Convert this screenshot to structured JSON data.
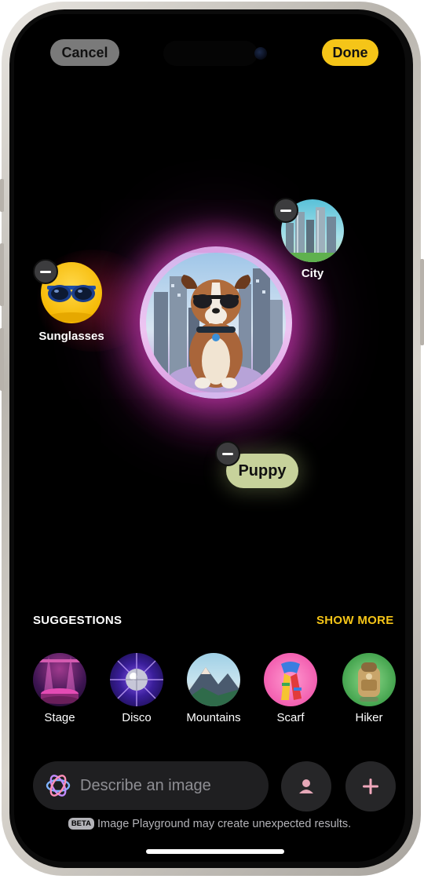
{
  "toolbar": {
    "cancel_label": "Cancel",
    "done_label": "Done"
  },
  "concepts": {
    "sunglasses_label": "Sunglasses",
    "city_label": "City",
    "puppy_label": "Puppy"
  },
  "suggestions": {
    "title": "SUGGESTIONS",
    "show_more_label": "SHOW MORE",
    "items": [
      {
        "label": "Stage"
      },
      {
        "label": "Disco"
      },
      {
        "label": "Mountains"
      },
      {
        "label": "Scarf"
      },
      {
        "label": "Hiker"
      }
    ]
  },
  "prompt": {
    "placeholder": "Describe an image"
  },
  "footer": {
    "beta_badge": "BETA",
    "disclaimer": "Image Playground may create unexpected results."
  },
  "colors": {
    "accent_yellow": "#f5c518",
    "puppy_pill": "#c7d29b",
    "glow_pink": "#f046d2"
  },
  "icons": {
    "person": "person-icon",
    "plus": "plus-icon",
    "playground": "image-playground-icon",
    "remove": "minus-icon"
  }
}
